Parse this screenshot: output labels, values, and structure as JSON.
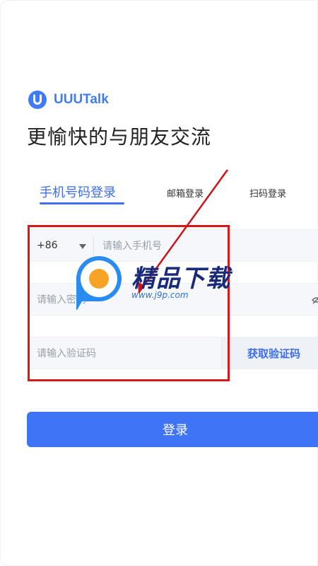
{
  "brand": {
    "name": "UUUTalk"
  },
  "headline": "更愉快的与朋友交流",
  "tabs": {
    "phone_login": "手机号码登录",
    "email_login": "邮箱登录",
    "qr_login": "扫码登录"
  },
  "form": {
    "country_code": "+86",
    "phone_placeholder": "请输入手机号",
    "password_placeholder": "请输入密码",
    "code_placeholder": "请输入验证码",
    "get_code_label": "获取验证码"
  },
  "login_button": "登录",
  "watermark": {
    "title": "精品下载",
    "url": "www.j9p.com"
  },
  "colors": {
    "accent": "#3d6df0",
    "button": "#3f74f6",
    "annotation": "#d91818"
  }
}
